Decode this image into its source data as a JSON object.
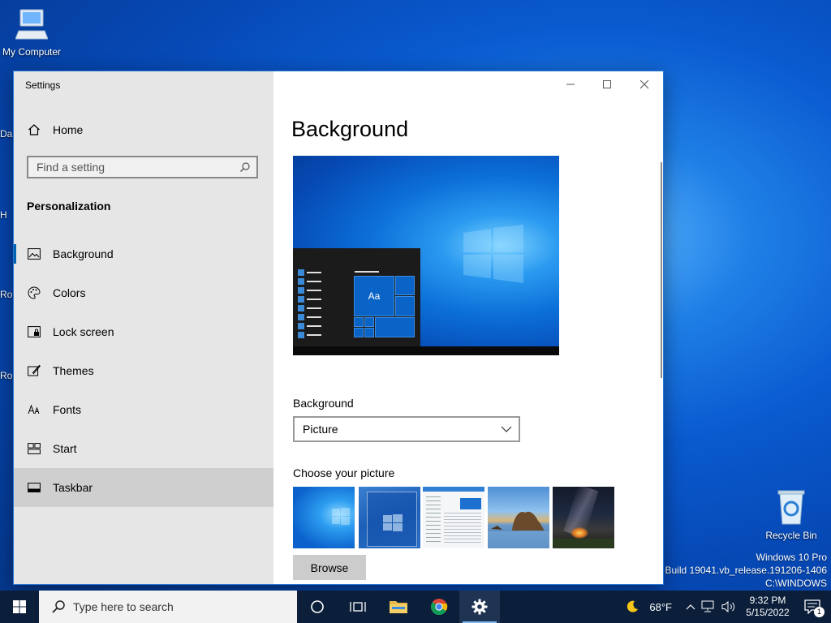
{
  "desktop": {
    "icons": [
      {
        "name": "my-computer",
        "label": "My Computer"
      },
      {
        "name": "recycle-bin",
        "label": "Recycle Bin"
      }
    ],
    "partial_labels": [
      "Da",
      "H",
      "Ro",
      "Ro"
    ],
    "watermark": {
      "line1": "Windows 10 Pro",
      "line2": "Build 19041.vb_release.191206-1406",
      "line3": "C:\\WINDOWS"
    }
  },
  "window": {
    "app_title": "Settings",
    "controls": {
      "minimize": "minimize-icon",
      "maximize": "maximize-icon",
      "close": "close-icon"
    }
  },
  "sidebar": {
    "home_label": "Home",
    "search_placeholder": "Find a setting",
    "section_title": "Personalization",
    "items": [
      {
        "label": "Background",
        "icon": "picture-icon",
        "selected": true
      },
      {
        "label": "Colors",
        "icon": "palette-icon"
      },
      {
        "label": "Lock screen",
        "icon": "lock-screen-icon"
      },
      {
        "label": "Themes",
        "icon": "themes-icon"
      },
      {
        "label": "Fonts",
        "icon": "fonts-icon"
      },
      {
        "label": "Start",
        "icon": "start-icon"
      },
      {
        "label": "Taskbar",
        "icon": "taskbar-icon",
        "hover": true
      }
    ]
  },
  "content": {
    "page_title": "Background",
    "preview_tile_text": "Aa",
    "background_label": "Background",
    "background_value": "Picture",
    "choose_label": "Choose your picture",
    "browse_label": "Browse"
  },
  "taskbar": {
    "search_placeholder": "Type here to search",
    "weather": "68°F",
    "time": "9:32 PM",
    "date": "5/15/2022",
    "notification_count": "1"
  },
  "colors": {
    "accent": "#0063b1",
    "sidebar_bg": "#e6e6e6",
    "taskbar_bg": "#0b1e3a"
  }
}
